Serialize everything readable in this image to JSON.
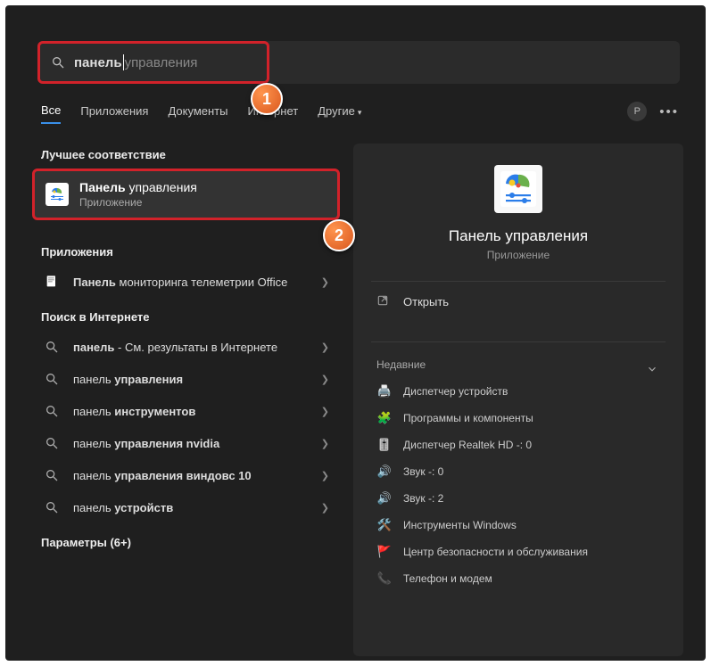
{
  "search": {
    "typed": "панель",
    "suggestion_tail": "управления"
  },
  "tabs": {
    "all": "Все",
    "apps": "Приложения",
    "documents": "Документы",
    "internet": "Интернет",
    "other": "Другие"
  },
  "avatar_initial": "Р",
  "left": {
    "best_match_heading": "Лучшее соответствие",
    "best_match": {
      "title_bold": "Панель",
      "title_rest": " управления",
      "subtitle": "Приложение"
    },
    "apps_heading": "Приложения",
    "app_item": {
      "bold": "Панель",
      "rest": " мониторинга телеметрии Office"
    },
    "web_heading": "Поиск в Интернете",
    "web_items": [
      {
        "bold": "панель",
        "rest": " - См. результаты в Интернете"
      },
      {
        "pre": "панель ",
        "bold": "управления",
        "rest": ""
      },
      {
        "pre": "панель ",
        "bold": "инструментов",
        "rest": ""
      },
      {
        "pre": "панель ",
        "bold": "управления nvidia",
        "rest": ""
      },
      {
        "pre": "панель ",
        "bold": "управления виндовс 10",
        "rest": ""
      },
      {
        "pre": "панель ",
        "bold": "устройств",
        "rest": ""
      }
    ],
    "settings_heading": "Параметры (6+)"
  },
  "right": {
    "title": "Панель управления",
    "subtitle": "Приложение",
    "open_label": "Открыть",
    "recent_heading": "Недавние",
    "recent": [
      "Диспетчер устройств",
      "Программы и компоненты",
      "Диспетчер Realtek HD -: 0",
      "Звук -: 0",
      "Звук -: 2",
      "Инструменты Windows",
      "Центр безопасности и обслуживания",
      "Телефон и модем"
    ]
  },
  "badges": {
    "one": "1",
    "two": "2"
  }
}
